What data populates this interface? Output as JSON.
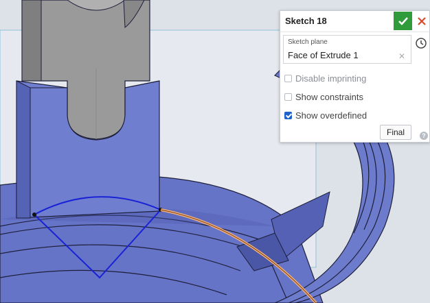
{
  "sketch_panel": {
    "title": "Sketch 18",
    "accept_icon": "checkmark-icon",
    "cancel_icon": "close-icon",
    "sketch_plane": {
      "label": "Sketch plane",
      "value": "Face of Extrude 1",
      "clear_icon": "clear-x-icon"
    },
    "history_icon": "history-clock-icon",
    "options": [
      {
        "label": "Disable imprinting",
        "checked": false,
        "enabled": false
      },
      {
        "label": "Show constraints",
        "checked": false,
        "enabled": true
      },
      {
        "label": "Show overdefined",
        "checked": true,
        "enabled": true
      }
    ],
    "final_label": "Final",
    "help_icon": "help-icon"
  },
  "colors": {
    "accept_green": "#2f9b3a",
    "cancel_red": "#d9482b",
    "part_blue": "#6674c8",
    "part_blue_dark": "#3f4a9a",
    "sketch_arc": "#1a22d6",
    "highlight_edge": "#f2b27e",
    "gray_part": "#9a9a9a"
  }
}
